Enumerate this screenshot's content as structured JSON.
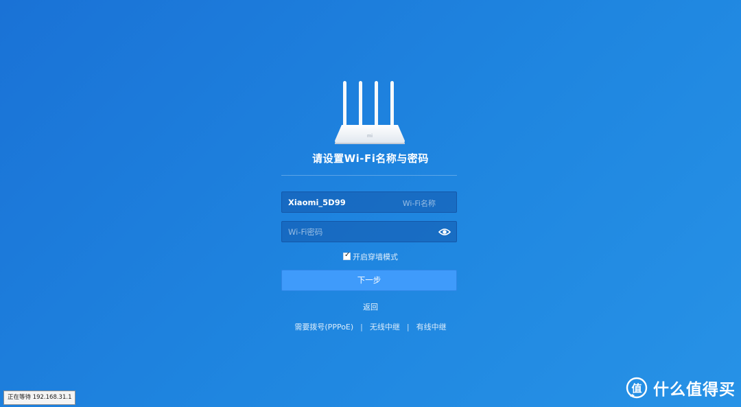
{
  "page": {
    "title": "请设置Wi-Fi名称与密码",
    "router_logo_text": "mi"
  },
  "form": {
    "ssid": {
      "value": "Xiaomi_5D99",
      "hint": "Wi-Fi名称"
    },
    "password": {
      "value": "",
      "placeholder": "Wi-Fi密码",
      "toggle_icon": "eye-icon"
    },
    "wall_mode": {
      "checked": true,
      "label": "开启穿墙模式"
    },
    "next_label": "下一步",
    "back_label": "返回"
  },
  "modes": {
    "pppoe_label": "需要拨号(PPPoE)",
    "separator": "|",
    "wireless_repeat_label": "无线中继",
    "wired_repeat_label": "有线中继"
  },
  "status_bar": {
    "text": "正在等待 192.168.31.1"
  },
  "watermark": {
    "icon": "zhi-logo-icon",
    "text": "什么值得买"
  },
  "colors": {
    "background_start": "#1a72d6",
    "background_end": "#2792e6",
    "button": "#3f9bfb",
    "field_border": "#1457a8"
  }
}
